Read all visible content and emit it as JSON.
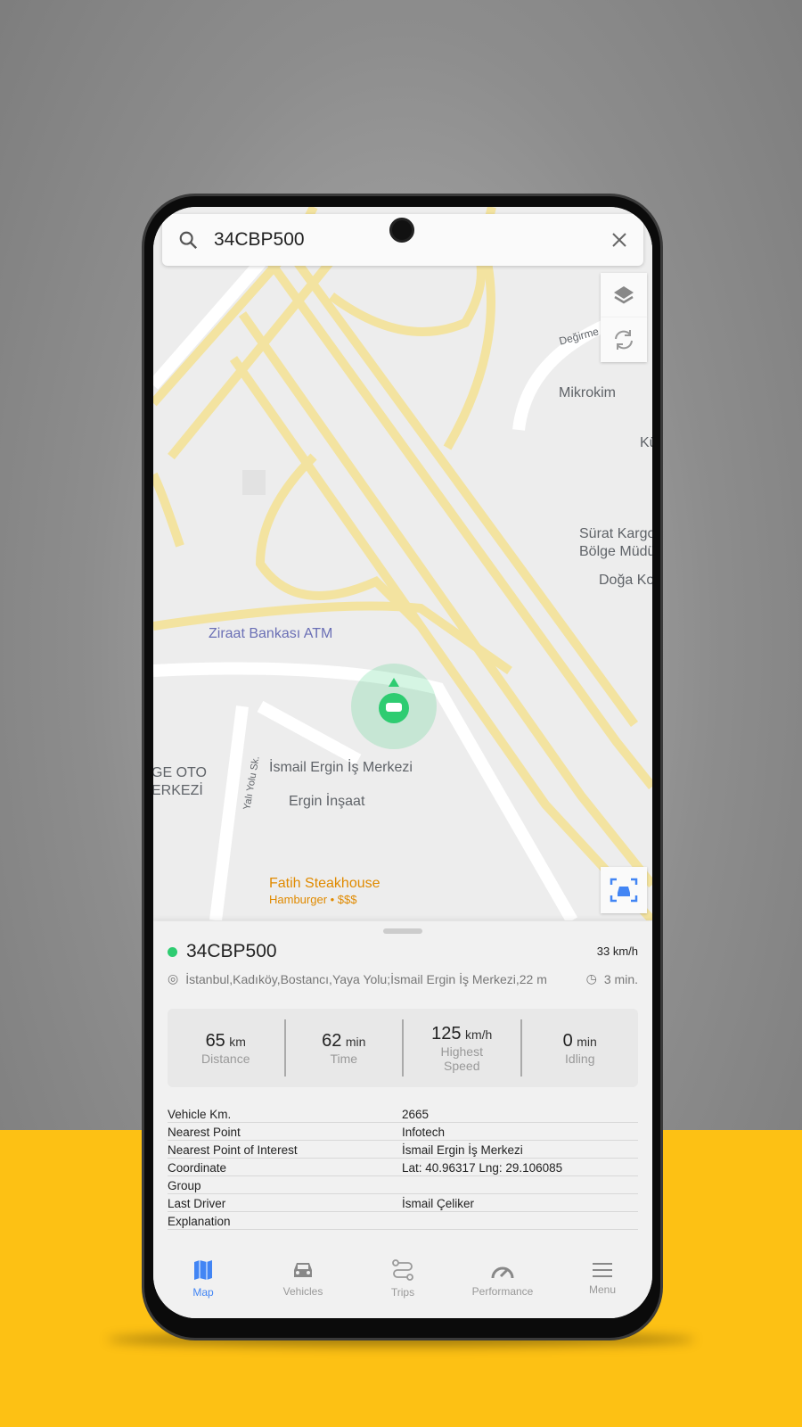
{
  "search": {
    "value": "34CBP500"
  },
  "map": {
    "labels": [
      "Değirme",
      "Mikrokim",
      "Kü",
      "Sürat Kargo",
      "Bölge Müdü",
      "Doğa Ko",
      "Ziraat Bankası ATM",
      "İsmail Ergin İş Merkezi",
      "Ergin İnşaat",
      "GE OTO",
      "ERKEZİ",
      "Yalı Yolu Sk.",
      "Fatih Steakhouse",
      "Hamburger • $$$"
    ],
    "vehicle_color": "#2ecc71"
  },
  "vehicle": {
    "plate": "34CBP500",
    "speed": "33 km/h",
    "address": "İstanbul,Kadıköy,Bostancı,Yaya Yolu;İsmail Ergin İş Merkezi,22 m",
    "ago": "3 min.",
    "status_color": "#2ecc71"
  },
  "stats": [
    {
      "value": "65",
      "unit": "km",
      "label": "Distance"
    },
    {
      "value": "62",
      "unit": "min",
      "label": "Time"
    },
    {
      "value": "125",
      "unit": "km/h",
      "label": "Highest Speed"
    },
    {
      "value": "0",
      "unit": "min",
      "label": "Idling"
    }
  ],
  "details": [
    {
      "k": "Vehicle Km.",
      "v": "2665"
    },
    {
      "k": "Nearest Point",
      "v": "Infotech"
    },
    {
      "k": "Nearest Point of Interest",
      "v": "İsmail Ergin İş Merkezi"
    },
    {
      "k": "Coordinate",
      "v": "Lat: 40.96317 Lng: 29.106085"
    },
    {
      "k": "Group",
      "v": ""
    },
    {
      "k": "Last Driver",
      "v": "İsmail Çeliker"
    },
    {
      "k": "Explanation",
      "v": ""
    }
  ],
  "nav": [
    {
      "label": "Map",
      "active": true
    },
    {
      "label": "Vehicles"
    },
    {
      "label": "Trips"
    },
    {
      "label": "Performance"
    },
    {
      "label": "Menu"
    }
  ],
  "accent": "#4285f4"
}
